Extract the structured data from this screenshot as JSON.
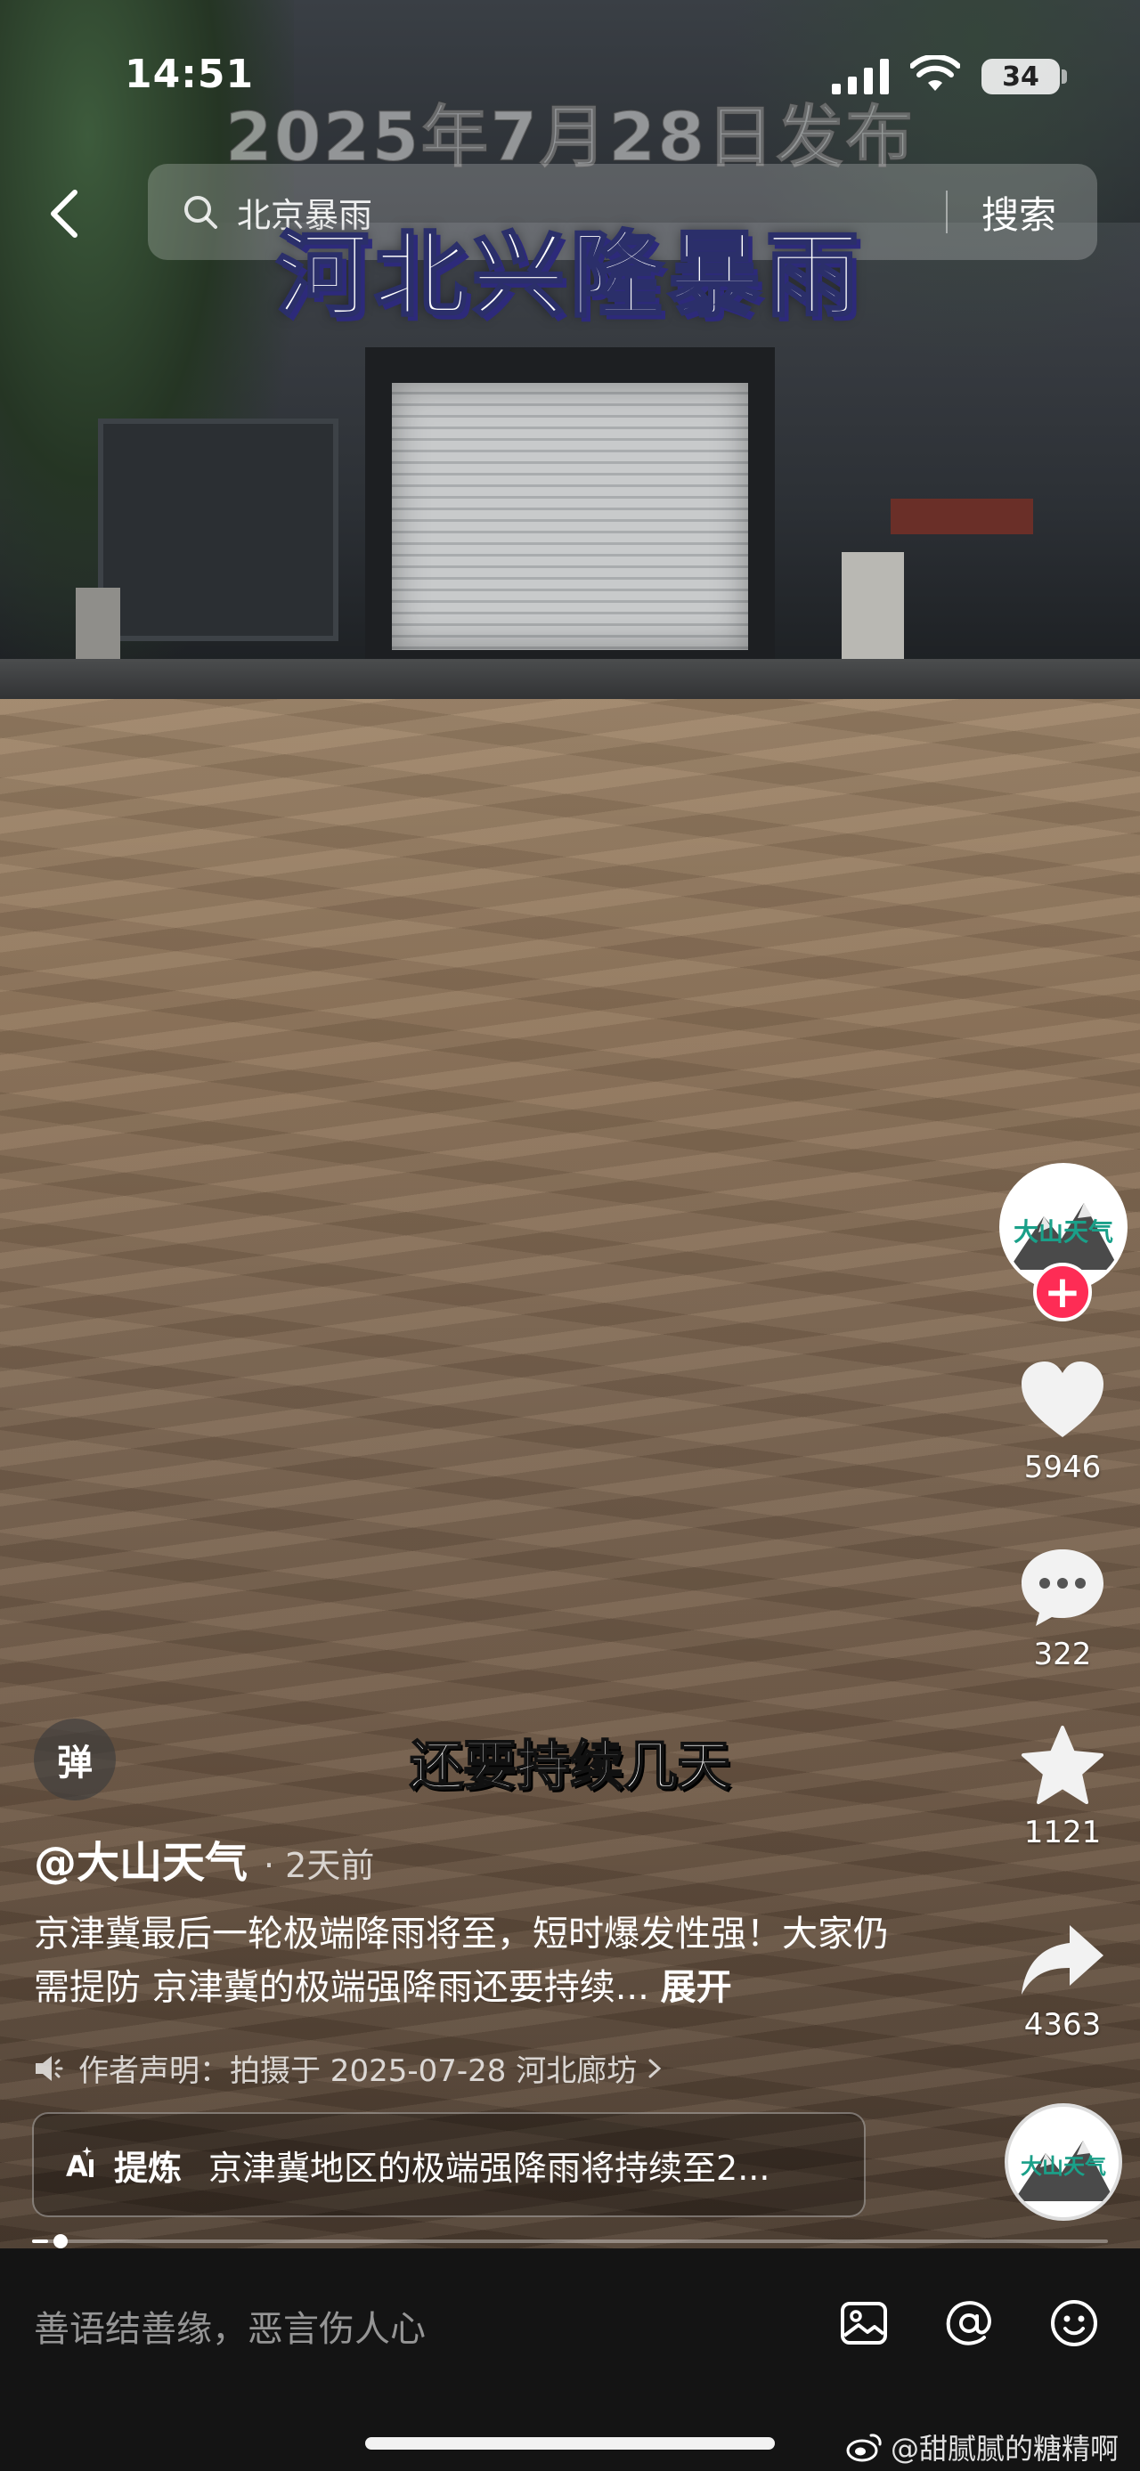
{
  "status_bar": {
    "time": "14:51",
    "battery": "34"
  },
  "search": {
    "query": "北京暴雨",
    "button_label": "搜索"
  },
  "overlay": {
    "date_caption": "2025年7月28日发布",
    "title_caption": "河北兴隆暴雨",
    "subtitle": "还要持续几天"
  },
  "creator": {
    "avatar_text": "大山天气"
  },
  "actions": {
    "likes": "5946",
    "comments": "322",
    "favorites": "1121",
    "shares": "4363"
  },
  "video_info": {
    "danmu_label": "弹",
    "author": "@大山天气",
    "time_ago": "· 2天前",
    "description": "京津冀最后一轮极端降雨将至，短时爆发性强！大家仍需提防 京津冀的极端强降雨还要持续...",
    "expand_label": "展开",
    "declaration": "作者声明：拍摄于 2025-07-28 河北廊坊",
    "ai_tag": "提炼",
    "ai_summary": "京津冀地区的极端强降雨将持续至2..."
  },
  "progress": 0.015,
  "comment_bar": {
    "placeholder": "善语结善缘，恶言伤人心"
  },
  "watermark": "@甜腻腻的糖精啊",
  "icons": [
    "back-icon",
    "search-icon",
    "heart-icon",
    "comment-icon",
    "star-icon",
    "share-icon",
    "image-icon",
    "at-icon",
    "emoji-icon",
    "speaker-icon",
    "ai-icon",
    "weibo-icon"
  ]
}
